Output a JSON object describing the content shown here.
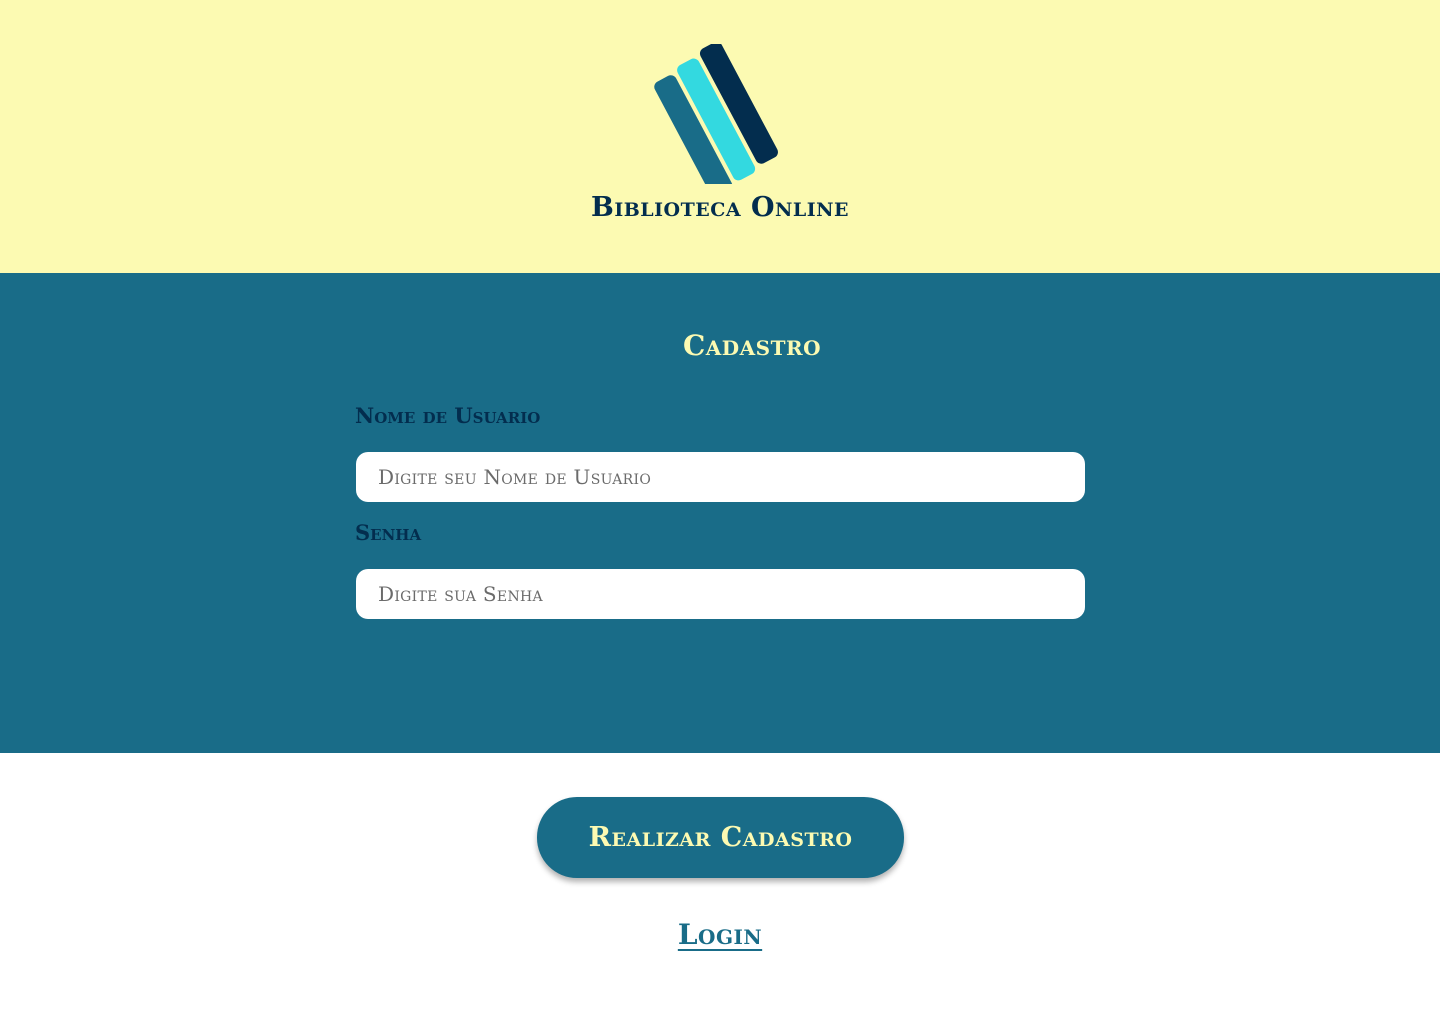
{
  "header": {
    "brand_title": "Biblioteca Online",
    "logo_icon": "stacked-books-icon",
    "colors": {
      "background": "#fcfab2",
      "book_left": "#196c88",
      "book_middle": "#33d9e0",
      "book_right": "#032d4e"
    }
  },
  "form": {
    "title": "Cadastro",
    "username": {
      "label": "Nome de Usuario",
      "placeholder": "Digite seu Nome de Usuario",
      "value": ""
    },
    "password": {
      "label": "Senha",
      "placeholder": "Digite sua Senha",
      "value": ""
    },
    "colors": {
      "panel_background": "#196c88",
      "title": "#fcfab2",
      "labels": "#032d4e"
    }
  },
  "actions": {
    "submit_label": "Realizar Cadastro",
    "login_link_label": "Login"
  }
}
